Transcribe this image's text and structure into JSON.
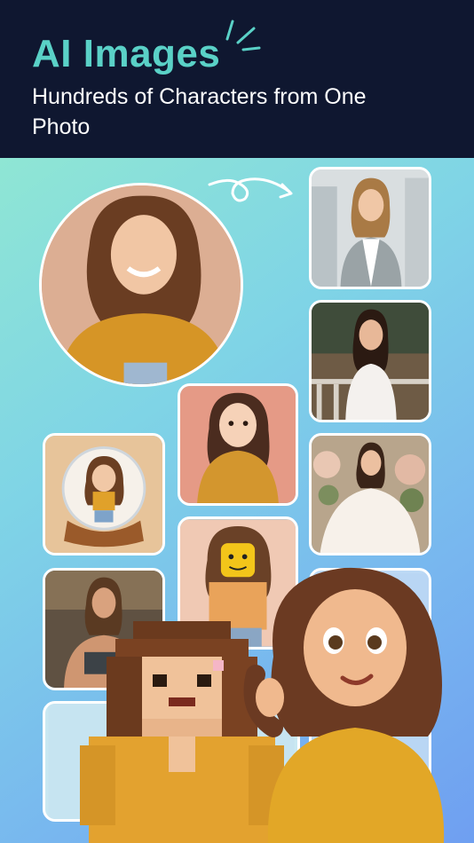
{
  "header": {
    "title": "AI Images",
    "subtitle": "Hundreds of Characters from One Photo"
  },
  "icons": {
    "sparkle": "sparkle-lines-icon",
    "arrow": "curly-arrow-icon"
  },
  "colors": {
    "header_bg": "#0f1730",
    "title_accent": "#5ad1c7",
    "gradient_start": "#8fe6d4",
    "gradient_end": "#6f9ff1"
  },
  "gallery": {
    "original": "original-portrait-photo",
    "styles": [
      "business-blazer-photo",
      "white-dress-balcony-photo",
      "bridal-gown-photo",
      "anime-sticker-illustration",
      "snow-globe-figurine",
      "toy-brick-minifigure",
      "fitness-gym-photo",
      "pixel-block-character",
      "3d-animated-character"
    ]
  }
}
